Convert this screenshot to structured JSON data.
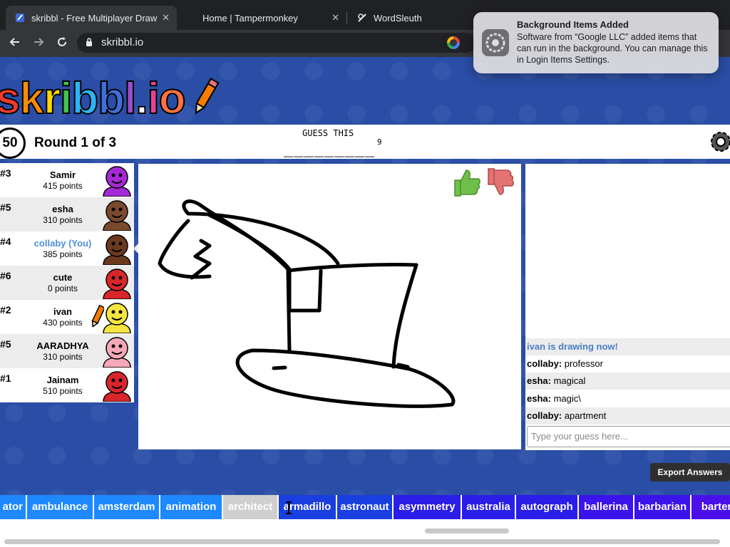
{
  "browser": {
    "tabs": [
      {
        "title": "skribbl - Free Multiplayer Draw",
        "close": "✕"
      },
      {
        "title": "Home | Tampermonkey",
        "close": "✕"
      },
      {
        "title": "WordSleuth"
      }
    ],
    "url": "skribbl.io",
    "icons": {
      "back": "arrow-left-icon",
      "forward": "arrow-right-icon",
      "reload": "reload-icon",
      "lock": "lock-icon",
      "google": "google-icon"
    }
  },
  "notification": {
    "title": "Background Items Added",
    "body": "Software from “Google LLC” added items that can run in the background. You can manage this in Login Items Settings."
  },
  "game": {
    "logo": {
      "letters": [
        "s",
        "k",
        "r",
        "i",
        "b",
        "b",
        "l",
        ".",
        "i",
        "o"
      ],
      "colors": [
        "#ef3b2c",
        "#fb8c00",
        "#ffd600",
        "#43c54b",
        "#29b6f6",
        "#3f6fd8",
        "#9c4dcc",
        "#ffffff",
        "#e84393",
        "#ff7043"
      ]
    },
    "timer": "50",
    "round": "Round 1 of 3",
    "guess_label": "GUESS THIS",
    "word_blanks": "_________",
    "word_length": "9",
    "players": [
      {
        "rank": "#3",
        "name": "Samir",
        "points": "415 points",
        "avatar": "purple-avatar-icon",
        "color": "#a52ad6"
      },
      {
        "rank": "#5",
        "name": "esha",
        "points": "310 points",
        "avatar": "brown-avatar-icon",
        "color": "#7b4a2c"
      },
      {
        "rank": "#4",
        "name": "collaby (You)",
        "points": "385 points",
        "avatar": "brown-avatar-icon",
        "color": "#6b3a1e",
        "you": true
      },
      {
        "rank": "#6",
        "name": "cute",
        "points": "0 points",
        "avatar": "red-avatar-icon",
        "color": "#d8262b"
      },
      {
        "rank": "#2",
        "name": "ivan",
        "points": "430 points",
        "avatar": "yellow-avatar-icon",
        "color": "#f4e542",
        "drawing": true
      },
      {
        "rank": "#5",
        "name": "AARADHYA",
        "points": "310 points",
        "avatar": "pink-avatar-icon",
        "color": "#f7a8b8"
      },
      {
        "rank": "#1",
        "name": "Jainam",
        "points": "510 points",
        "avatar": "red-avatar-icon",
        "color": "#d8262b"
      }
    ],
    "tooltip": "apartment",
    "chat": [
      {
        "type": "system",
        "text": "ivan is drawing now!"
      },
      {
        "user": "collaby:",
        "text": " professor"
      },
      {
        "user": "esha:",
        "text": " magical"
      },
      {
        "user": "esha:",
        "text": " magic\\"
      },
      {
        "user": "collaby:",
        "text": " apartment"
      }
    ],
    "chat_placeholder": "Type your guess here...",
    "export_label": "Export Answers",
    "words": [
      {
        "label": "ator",
        "color": "#1e88ff"
      },
      {
        "label": "ambulance",
        "color": "#1e88ff"
      },
      {
        "label": "amsterdam",
        "color": "#1e88ff"
      },
      {
        "label": "animation",
        "color": "#1e88ff"
      },
      {
        "label": "architect",
        "color": "#cfcfcf",
        "selected": true
      },
      {
        "label": "armadillo",
        "color": "#1a3fe0"
      },
      {
        "label": "astronaut",
        "color": "#1a3fe0"
      },
      {
        "label": "asymmetry",
        "color": "#2a1ee8"
      },
      {
        "label": "australia",
        "color": "#2a1ee8"
      },
      {
        "label": "autograph",
        "color": "#2a1ee8"
      },
      {
        "label": "ballerina",
        "color": "#3a14ea"
      },
      {
        "label": "barbarian",
        "color": "#3a14ea"
      },
      {
        "label": "barter",
        "color": "#4b10ea"
      }
    ]
  }
}
